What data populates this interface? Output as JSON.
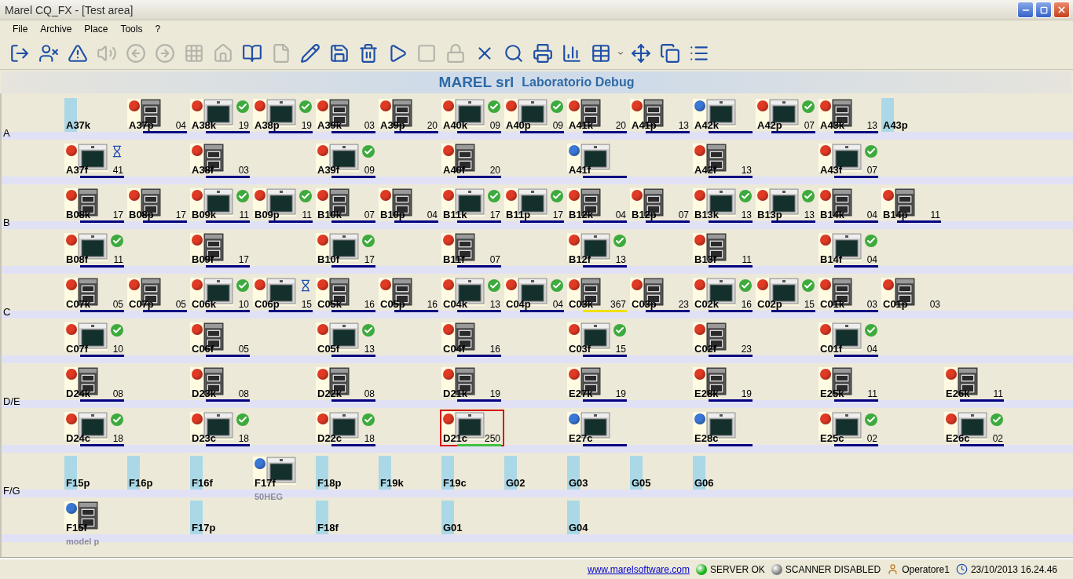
{
  "window": {
    "title": "Marel CQ_FX - [Test area]"
  },
  "menu": [
    "File",
    "Archive",
    "Place",
    "Tools",
    "?"
  ],
  "toolbar": [
    {
      "kind": "exit",
      "disabled": false
    },
    {
      "kind": "user-remove",
      "disabled": false
    },
    {
      "kind": "warning",
      "disabled": false
    },
    {
      "kind": "sound",
      "disabled": true
    },
    {
      "kind": "back",
      "disabled": true
    },
    {
      "kind": "forward",
      "disabled": true
    },
    {
      "kind": "grid",
      "disabled": true
    },
    {
      "kind": "home",
      "disabled": true
    },
    {
      "kind": "book",
      "disabled": false
    },
    {
      "kind": "page",
      "disabled": true
    },
    {
      "kind": "edit",
      "disabled": false
    },
    {
      "kind": "save",
      "disabled": false
    },
    {
      "kind": "bin",
      "disabled": false
    },
    {
      "kind": "play",
      "disabled": false
    },
    {
      "kind": "stop",
      "disabled": true
    },
    {
      "kind": "lock",
      "disabled": true
    },
    {
      "kind": "delete",
      "disabled": false
    },
    {
      "kind": "search",
      "disabled": false
    },
    {
      "kind": "print",
      "disabled": false
    },
    {
      "kind": "report",
      "disabled": false
    },
    {
      "kind": "table",
      "disabled": false
    },
    {
      "kind": "move",
      "disabled": false
    },
    {
      "kind": "copy",
      "disabled": false
    },
    {
      "kind": "list",
      "disabled": false
    }
  ],
  "header": {
    "company": "MAREL srl",
    "lab": "Laboratorio Debug"
  },
  "groups": [
    {
      "label": "A",
      "rows": [
        [
          {
            "kind": "slot",
            "label": "A37k",
            "selected": false
          },
          {
            "kind": "station",
            "label": "A37p",
            "color": "#e03a25",
            "double": true,
            "done": false,
            "waiting": false,
            "count": "04",
            "bar": {
              "color": "#000080"
            },
            "selected": false
          },
          {
            "kind": "station",
            "label": "A38k",
            "color": "#e03a25",
            "double": false,
            "done": true,
            "waiting": false,
            "count": "19",
            "bar": {
              "color": "#000080"
            },
            "selected": false
          },
          {
            "kind": "station",
            "label": "A38p",
            "color": "#e03a25",
            "double": false,
            "done": true,
            "waiting": false,
            "count": "19",
            "bar": {
              "color": "#000080"
            },
            "selected": false
          },
          {
            "kind": "station",
            "label": "A39k",
            "color": "#e03a25",
            "double": true,
            "done": false,
            "waiting": false,
            "count": "03",
            "bar": {
              "color": "#000080"
            },
            "selected": false
          },
          {
            "kind": "station",
            "label": "A39p",
            "color": "#e03a25",
            "double": true,
            "done": false,
            "waiting": false,
            "count": "20",
            "bar": {
              "color": "#000080"
            },
            "selected": false
          },
          {
            "kind": "station",
            "label": "A40k",
            "color": "#e03a25",
            "double": false,
            "done": true,
            "waiting": false,
            "count": "09",
            "bar": {
              "color": "#000080"
            },
            "selected": false
          },
          {
            "kind": "station",
            "label": "A40p",
            "color": "#e03a25",
            "double": false,
            "done": true,
            "waiting": false,
            "count": "09",
            "bar": {
              "color": "#000080"
            },
            "selected": false
          },
          {
            "kind": "station",
            "label": "A41k",
            "color": "#e03a25",
            "double": true,
            "done": false,
            "waiting": false,
            "count": "20",
            "bar": {
              "color": "#000080"
            },
            "selected": false
          },
          {
            "kind": "station",
            "label": "A41p",
            "color": "#e03a25",
            "double": true,
            "done": false,
            "waiting": false,
            "count": "13",
            "bar": {
              "color": "#000080"
            },
            "selected": false
          },
          {
            "kind": "station",
            "label": "A42k",
            "color": "#3a78d8",
            "double": false,
            "done": false,
            "waiting": false,
            "bar": {
              "color": "#000080"
            },
            "selected": false
          },
          {
            "kind": "station",
            "label": "A42p",
            "color": "#e03a25",
            "double": false,
            "done": true,
            "waiting": false,
            "count": "07",
            "bar": {
              "color": "#000080"
            },
            "selected": false
          },
          {
            "kind": "station",
            "label": "A43k",
            "color": "#e03a25",
            "double": true,
            "done": false,
            "waiting": false,
            "count": "13",
            "bar": {
              "color": "#000080"
            },
            "selected": false
          },
          {
            "kind": "slot",
            "label": "A43p",
            "selected": false
          }
        ],
        [
          {
            "kind": "station",
            "label": "A37f",
            "color": "#e03a25",
            "double": false,
            "done": false,
            "waiting": true,
            "count": "41",
            "bar": {
              "color": "#000080"
            },
            "selected": false
          },
          {
            "kind": "gap"
          },
          {
            "kind": "station",
            "label": "A38f",
            "color": "#e03a25",
            "double": true,
            "done": false,
            "waiting": false,
            "count": "03",
            "bar": {
              "color": "#000080"
            },
            "selected": false
          },
          {
            "kind": "gap"
          },
          {
            "kind": "station",
            "label": "A39f",
            "color": "#e03a25",
            "double": false,
            "done": true,
            "waiting": false,
            "count": "09",
            "bar": {
              "color": "#000080"
            },
            "selected": false
          },
          {
            "kind": "gap"
          },
          {
            "kind": "station",
            "label": "A40f",
            "color": "#e03a25",
            "double": true,
            "done": false,
            "waiting": false,
            "count": "20",
            "bar": {
              "color": "#000080"
            },
            "selected": false
          },
          {
            "kind": "gap"
          },
          {
            "kind": "station",
            "label": "A41f",
            "color": "#3a78d8",
            "double": false,
            "done": false,
            "waiting": false,
            "bar": {
              "color": "#000080"
            },
            "selected": false
          },
          {
            "kind": "gap"
          },
          {
            "kind": "station",
            "label": "A42f",
            "color": "#e03a25",
            "double": true,
            "done": false,
            "waiting": false,
            "count": "13",
            "bar": {
              "color": "#000080"
            },
            "selected": false
          },
          {
            "kind": "gap"
          },
          {
            "kind": "station",
            "label": "A43f",
            "color": "#e03a25",
            "double": false,
            "done": true,
            "waiting": false,
            "count": "07",
            "bar": {
              "color": "#000080"
            },
            "selected": false
          }
        ]
      ]
    },
    {
      "label": "B",
      "rows": [
        [
          {
            "kind": "station",
            "label": "B08k",
            "color": "#e03a25",
            "double": true,
            "done": false,
            "waiting": false,
            "count": "17",
            "bar": {
              "color": "#000080"
            },
            "selected": false
          },
          {
            "kind": "station",
            "label": "B08p",
            "color": "#e03a25",
            "double": true,
            "done": false,
            "waiting": false,
            "count": "17",
            "bar": {
              "color": "#000080"
            },
            "selected": false
          },
          {
            "kind": "station",
            "label": "B09k",
            "color": "#e03a25",
            "double": false,
            "done": true,
            "waiting": false,
            "count": "11",
            "bar": {
              "color": "#000080"
            },
            "selected": false
          },
          {
            "kind": "station",
            "label": "B09p",
            "color": "#e03a25",
            "double": false,
            "done": true,
            "waiting": false,
            "count": "11",
            "bar": {
              "color": "#000080"
            },
            "selected": false
          },
          {
            "kind": "station",
            "label": "B10k",
            "color": "#e03a25",
            "double": true,
            "done": false,
            "waiting": false,
            "count": "07",
            "bar": {
              "color": "#000080"
            },
            "selected": false
          },
          {
            "kind": "station",
            "label": "B10p",
            "color": "#e03a25",
            "double": true,
            "done": false,
            "waiting": false,
            "count": "04",
            "bar": {
              "color": "#000080"
            },
            "selected": false
          },
          {
            "kind": "station",
            "label": "B11k",
            "color": "#e03a25",
            "double": false,
            "done": true,
            "waiting": false,
            "count": "17",
            "bar": {
              "color": "#000080"
            },
            "selected": false
          },
          {
            "kind": "station",
            "label": "B11p",
            "color": "#e03a25",
            "double": false,
            "done": true,
            "waiting": false,
            "count": "17",
            "bar": {
              "color": "#000080"
            },
            "selected": false
          },
          {
            "kind": "station",
            "label": "B12k",
            "color": "#e03a25",
            "double": true,
            "done": false,
            "waiting": false,
            "count": "04",
            "bar": {
              "color": "#000080"
            },
            "selected": false
          },
          {
            "kind": "station",
            "label": "B12p",
            "color": "#e03a25",
            "double": true,
            "done": false,
            "waiting": false,
            "count": "07",
            "bar": {
              "color": "#000080"
            },
            "selected": false
          },
          {
            "kind": "station",
            "label": "B13k",
            "color": "#e03a25",
            "double": false,
            "done": true,
            "waiting": false,
            "count": "13",
            "bar": {
              "color": "#000080"
            },
            "selected": false
          },
          {
            "kind": "station",
            "label": "B13p",
            "color": "#e03a25",
            "double": false,
            "done": true,
            "waiting": false,
            "count": "13",
            "bar": {
              "color": "#000080"
            },
            "selected": false
          },
          {
            "kind": "station",
            "label": "B14k",
            "color": "#e03a25",
            "double": true,
            "done": false,
            "waiting": false,
            "count": "04",
            "bar": {
              "color": "#000080"
            },
            "selected": false
          },
          {
            "kind": "station",
            "label": "B14p",
            "color": "#e03a25",
            "double": true,
            "done": false,
            "waiting": false,
            "count": "11",
            "bar": {
              "color": "#000080"
            },
            "selected": false
          }
        ],
        [
          {
            "kind": "station",
            "label": "B08f",
            "color": "#e03a25",
            "double": false,
            "done": true,
            "waiting": false,
            "count": "11",
            "bar": {
              "color": "#000080"
            },
            "selected": false
          },
          {
            "kind": "gap"
          },
          {
            "kind": "station",
            "label": "B09f",
            "color": "#e03a25",
            "double": true,
            "done": false,
            "waiting": false,
            "count": "17",
            "bar": {
              "color": "#000080"
            },
            "selected": false
          },
          {
            "kind": "gap"
          },
          {
            "kind": "station",
            "label": "B10f",
            "color": "#e03a25",
            "double": false,
            "done": true,
            "waiting": false,
            "count": "17",
            "bar": {
              "color": "#000080"
            },
            "selected": false
          },
          {
            "kind": "gap"
          },
          {
            "kind": "station",
            "label": "B11f",
            "color": "#e03a25",
            "double": true,
            "done": false,
            "waiting": false,
            "count": "07",
            "bar": {
              "color": "#000080"
            },
            "selected": false
          },
          {
            "kind": "gap"
          },
          {
            "kind": "station",
            "label": "B12f",
            "color": "#e03a25",
            "double": false,
            "done": true,
            "waiting": false,
            "count": "13",
            "bar": {
              "color": "#000080"
            },
            "selected": false
          },
          {
            "kind": "gap"
          },
          {
            "kind": "station",
            "label": "B13f",
            "color": "#e03a25",
            "double": true,
            "done": false,
            "waiting": false,
            "count": "11",
            "bar": {
              "color": "#000080"
            },
            "selected": false
          },
          {
            "kind": "gap"
          },
          {
            "kind": "station",
            "label": "B14f",
            "color": "#e03a25",
            "double": false,
            "done": true,
            "waiting": false,
            "count": "04",
            "bar": {
              "color": "#000080"
            },
            "selected": false
          }
        ]
      ]
    },
    {
      "label": "C",
      "rows": [
        [
          {
            "kind": "station",
            "label": "C07k",
            "color": "#e03a25",
            "double": true,
            "done": false,
            "waiting": false,
            "count": "05",
            "bar": {
              "color": "#000080"
            },
            "selected": false
          },
          {
            "kind": "station",
            "label": "C07p",
            "color": "#e03a25",
            "double": true,
            "done": false,
            "waiting": false,
            "count": "05",
            "bar": {
              "color": "#000080"
            },
            "selected": false
          },
          {
            "kind": "station",
            "label": "C06k",
            "color": "#e03a25",
            "double": false,
            "done": true,
            "waiting": false,
            "count": "10",
            "bar": {
              "color": "#000080"
            },
            "selected": false
          },
          {
            "kind": "station",
            "label": "C06p",
            "color": "#e03a25",
            "double": false,
            "done": false,
            "waiting": true,
            "count": "15",
            "bar": {
              "color": "#000080"
            },
            "selected": false
          },
          {
            "kind": "station",
            "label": "C05k",
            "color": "#e03a25",
            "double": true,
            "done": false,
            "waiting": false,
            "count": "16",
            "bar": {
              "color": "#000080"
            },
            "selected": false
          },
          {
            "kind": "station",
            "label": "C05p",
            "color": "#e03a25",
            "double": true,
            "done": false,
            "waiting": false,
            "count": "16",
            "bar": {
              "color": "#000080"
            },
            "selected": false
          },
          {
            "kind": "station",
            "label": "C04k",
            "color": "#e03a25",
            "double": false,
            "done": true,
            "waiting": false,
            "count": "13",
            "bar": {
              "color": "#000080"
            },
            "selected": false
          },
          {
            "kind": "station",
            "label": "C04p",
            "color": "#e03a25",
            "double": false,
            "done": true,
            "waiting": false,
            "count": "04",
            "bar": {
              "color": "#000080"
            },
            "selected": false
          },
          {
            "kind": "station",
            "label": "C03k",
            "color": "#e03a25",
            "double": true,
            "done": false,
            "waiting": false,
            "count": "367",
            "bar": {
              "color": "#f0e000"
            },
            "selected": false
          },
          {
            "kind": "station",
            "label": "C03p",
            "color": "#e03a25",
            "double": true,
            "done": false,
            "waiting": false,
            "count": "23",
            "bar": {
              "color": "#000080"
            },
            "selected": false
          },
          {
            "kind": "station",
            "label": "C02k",
            "color": "#e03a25",
            "double": false,
            "done": true,
            "waiting": false,
            "count": "16",
            "bar": {
              "color": "#000080"
            },
            "selected": false
          },
          {
            "kind": "station",
            "label": "C02p",
            "color": "#e03a25",
            "double": false,
            "done": true,
            "waiting": false,
            "count": "15",
            "bar": {
              "color": "#000080"
            },
            "selected": false
          },
          {
            "kind": "station",
            "label": "C01k",
            "color": "#e03a25",
            "double": true,
            "done": false,
            "waiting": false,
            "count": "03",
            "bar": {
              "color": "#000080"
            },
            "selected": false
          },
          {
            "kind": "station",
            "label": "C01p",
            "color": "#e03a25",
            "double": true,
            "done": false,
            "waiting": false,
            "count": "03",
            "selected": false
          }
        ],
        [
          {
            "kind": "station",
            "label": "C07f",
            "color": "#e03a25",
            "double": false,
            "done": true,
            "waiting": false,
            "count": "10",
            "bar": {
              "color": "#000080"
            },
            "selected": false
          },
          {
            "kind": "gap"
          },
          {
            "kind": "station",
            "label": "C06f",
            "color": "#e03a25",
            "double": true,
            "done": false,
            "waiting": false,
            "count": "05",
            "bar": {
              "color": "#000080"
            },
            "selected": false
          },
          {
            "kind": "gap"
          },
          {
            "kind": "station",
            "label": "C05f",
            "color": "#e03a25",
            "double": false,
            "done": true,
            "waiting": false,
            "count": "13",
            "bar": {
              "color": "#000080"
            },
            "selected": false
          },
          {
            "kind": "gap"
          },
          {
            "kind": "station",
            "label": "C04f",
            "color": "#e03a25",
            "double": true,
            "done": false,
            "waiting": false,
            "count": "16",
            "bar": {
              "color": "#000080"
            },
            "selected": false
          },
          {
            "kind": "gap"
          },
          {
            "kind": "station",
            "label": "C03f",
            "color": "#e03a25",
            "double": false,
            "done": true,
            "waiting": false,
            "count": "15",
            "bar": {
              "color": "#000080"
            },
            "selected": false
          },
          {
            "kind": "gap"
          },
          {
            "kind": "station",
            "label": "C02f",
            "color": "#e03a25",
            "double": true,
            "done": false,
            "waiting": false,
            "count": "23",
            "bar": {
              "color": "#000080"
            },
            "selected": false
          },
          {
            "kind": "gap"
          },
          {
            "kind": "station",
            "label": "C01f",
            "color": "#e03a25",
            "double": false,
            "done": true,
            "waiting": false,
            "count": "04",
            "bar": {
              "color": "#000080"
            },
            "selected": false
          }
        ]
      ]
    },
    {
      "label": "D/E",
      "rows": [
        [
          {
            "kind": "station",
            "label": "D24k",
            "color": "#e03a25",
            "double": true,
            "done": false,
            "waiting": false,
            "count": "08",
            "bar": {
              "color": "#000080"
            },
            "selected": false
          },
          {
            "kind": "gap"
          },
          {
            "kind": "station",
            "label": "D23k",
            "color": "#e03a25",
            "double": true,
            "done": false,
            "waiting": false,
            "count": "08",
            "bar": {
              "color": "#000080"
            },
            "selected": false
          },
          {
            "kind": "gap"
          },
          {
            "kind": "station",
            "label": "D22k",
            "color": "#e03a25",
            "double": true,
            "done": false,
            "waiting": false,
            "count": "08",
            "bar": {
              "color": "#000080"
            },
            "selected": false
          },
          {
            "kind": "gap"
          },
          {
            "kind": "station",
            "label": "D21k",
            "color": "#e03a25",
            "double": true,
            "done": false,
            "waiting": false,
            "count": "19",
            "bar": {
              "color": "#000080"
            },
            "selected": false
          },
          {
            "kind": "gap"
          },
          {
            "kind": "station",
            "label": "E27k",
            "color": "#e03a25",
            "double": true,
            "done": false,
            "waiting": false,
            "count": "19",
            "bar": {
              "color": "#000080"
            },
            "selected": false
          },
          {
            "kind": "gap"
          },
          {
            "kind": "station",
            "label": "E28k",
            "color": "#e03a25",
            "double": true,
            "done": false,
            "waiting": false,
            "count": "19",
            "bar": {
              "color": "#000080"
            },
            "selected": false
          },
          {
            "kind": "gap"
          },
          {
            "kind": "station",
            "label": "E25k",
            "color": "#e03a25",
            "double": true,
            "done": false,
            "waiting": false,
            "count": "11",
            "bar": {
              "color": "#000080"
            },
            "selected": false
          },
          {
            "kind": "gap"
          },
          {
            "kind": "station",
            "label": "E26k",
            "color": "#e03a25",
            "double": true,
            "done": false,
            "waiting": false,
            "count": "11",
            "bar": {
              "color": "#000080"
            },
            "selected": false
          }
        ],
        [
          {
            "kind": "station",
            "label": "D24c",
            "color": "#e03a25",
            "double": false,
            "done": true,
            "waiting": false,
            "count": "18",
            "bar": {
              "color": "#000080"
            },
            "selected": false
          },
          {
            "kind": "gap"
          },
          {
            "kind": "station",
            "label": "D23c",
            "color": "#e03a25",
            "double": false,
            "done": true,
            "waiting": false,
            "count": "18",
            "bar": {
              "color": "#000080"
            },
            "selected": false
          },
          {
            "kind": "gap"
          },
          {
            "kind": "station",
            "label": "D22c",
            "color": "#e03a25",
            "double": false,
            "done": true,
            "waiting": false,
            "count": "18",
            "bar": {
              "color": "#000080"
            },
            "selected": false
          },
          {
            "kind": "gap"
          },
          {
            "kind": "station",
            "label": "D21c",
            "color": "#e03a25",
            "double": false,
            "done": false,
            "waiting": false,
            "count": "250",
            "bar": {
              "color": "#40c040"
            },
            "selected": true
          },
          {
            "kind": "gap"
          },
          {
            "kind": "station",
            "label": "E27c",
            "color": "#3a78d8",
            "double": false,
            "done": false,
            "waiting": false,
            "bar": {
              "color": "#000080"
            },
            "selected": false
          },
          {
            "kind": "gap"
          },
          {
            "kind": "station",
            "label": "E28c",
            "color": "#3a78d8",
            "double": false,
            "done": false,
            "waiting": false,
            "bar": {
              "color": "#000080"
            },
            "selected": false
          },
          {
            "kind": "gap"
          },
          {
            "kind": "station",
            "label": "E25c",
            "color": "#e03a25",
            "double": false,
            "done": true,
            "waiting": false,
            "count": "02",
            "bar": {
              "color": "#000080"
            },
            "selected": false
          },
          {
            "kind": "gap"
          },
          {
            "kind": "station",
            "label": "E26c",
            "color": "#e03a25",
            "double": false,
            "done": true,
            "waiting": false,
            "count": "02",
            "bar": {
              "color": "#000080"
            },
            "selected": false
          }
        ]
      ]
    },
    {
      "label": "F/G",
      "rows": [
        [
          {
            "kind": "slot",
            "label": "F15p",
            "selected": false
          },
          {
            "kind": "slot",
            "label": "F16p",
            "selected": false
          },
          {
            "kind": "slot",
            "label": "F16f",
            "selected": false
          },
          {
            "kind": "station",
            "label": "F17f",
            "color": "#3a78d8",
            "double": false,
            "done": false,
            "waiting": false,
            "model": "50HEG",
            "selected": false
          },
          {
            "kind": "slot",
            "label": "F18p",
            "selected": false
          },
          {
            "kind": "slot",
            "label": "F19k",
            "selected": false
          },
          {
            "kind": "slot",
            "label": "F19c",
            "selected": false
          },
          {
            "kind": "slot",
            "label": "G02",
            "selected": false
          },
          {
            "kind": "slot",
            "label": "G03",
            "selected": false
          },
          {
            "kind": "slot",
            "label": "G05",
            "selected": false
          },
          {
            "kind": "slot",
            "label": "G06",
            "selected": false
          }
        ],
        [
          {
            "kind": "station",
            "label": "F15f",
            "color": "#3a78d8",
            "double": true,
            "done": false,
            "waiting": false,
            "model": "model p",
            "selected": false
          },
          {
            "kind": "gap"
          },
          {
            "kind": "slot",
            "label": "F17p",
            "selected": false
          },
          {
            "kind": "gap"
          },
          {
            "kind": "slot",
            "label": "F18f",
            "selected": false
          },
          {
            "kind": "gap"
          },
          {
            "kind": "slot",
            "label": "G01",
            "selected": false
          },
          {
            "kind": "gap"
          },
          {
            "kind": "slot",
            "label": "G04",
            "selected": false
          }
        ]
      ]
    }
  ],
  "status_bar": {
    "link": "www.marelsoftware.com",
    "server": "SERVER OK",
    "scanner": "SCANNER DISABLED",
    "user": "Operatore1",
    "datetime": "23/10/2013 16.24.46"
  }
}
